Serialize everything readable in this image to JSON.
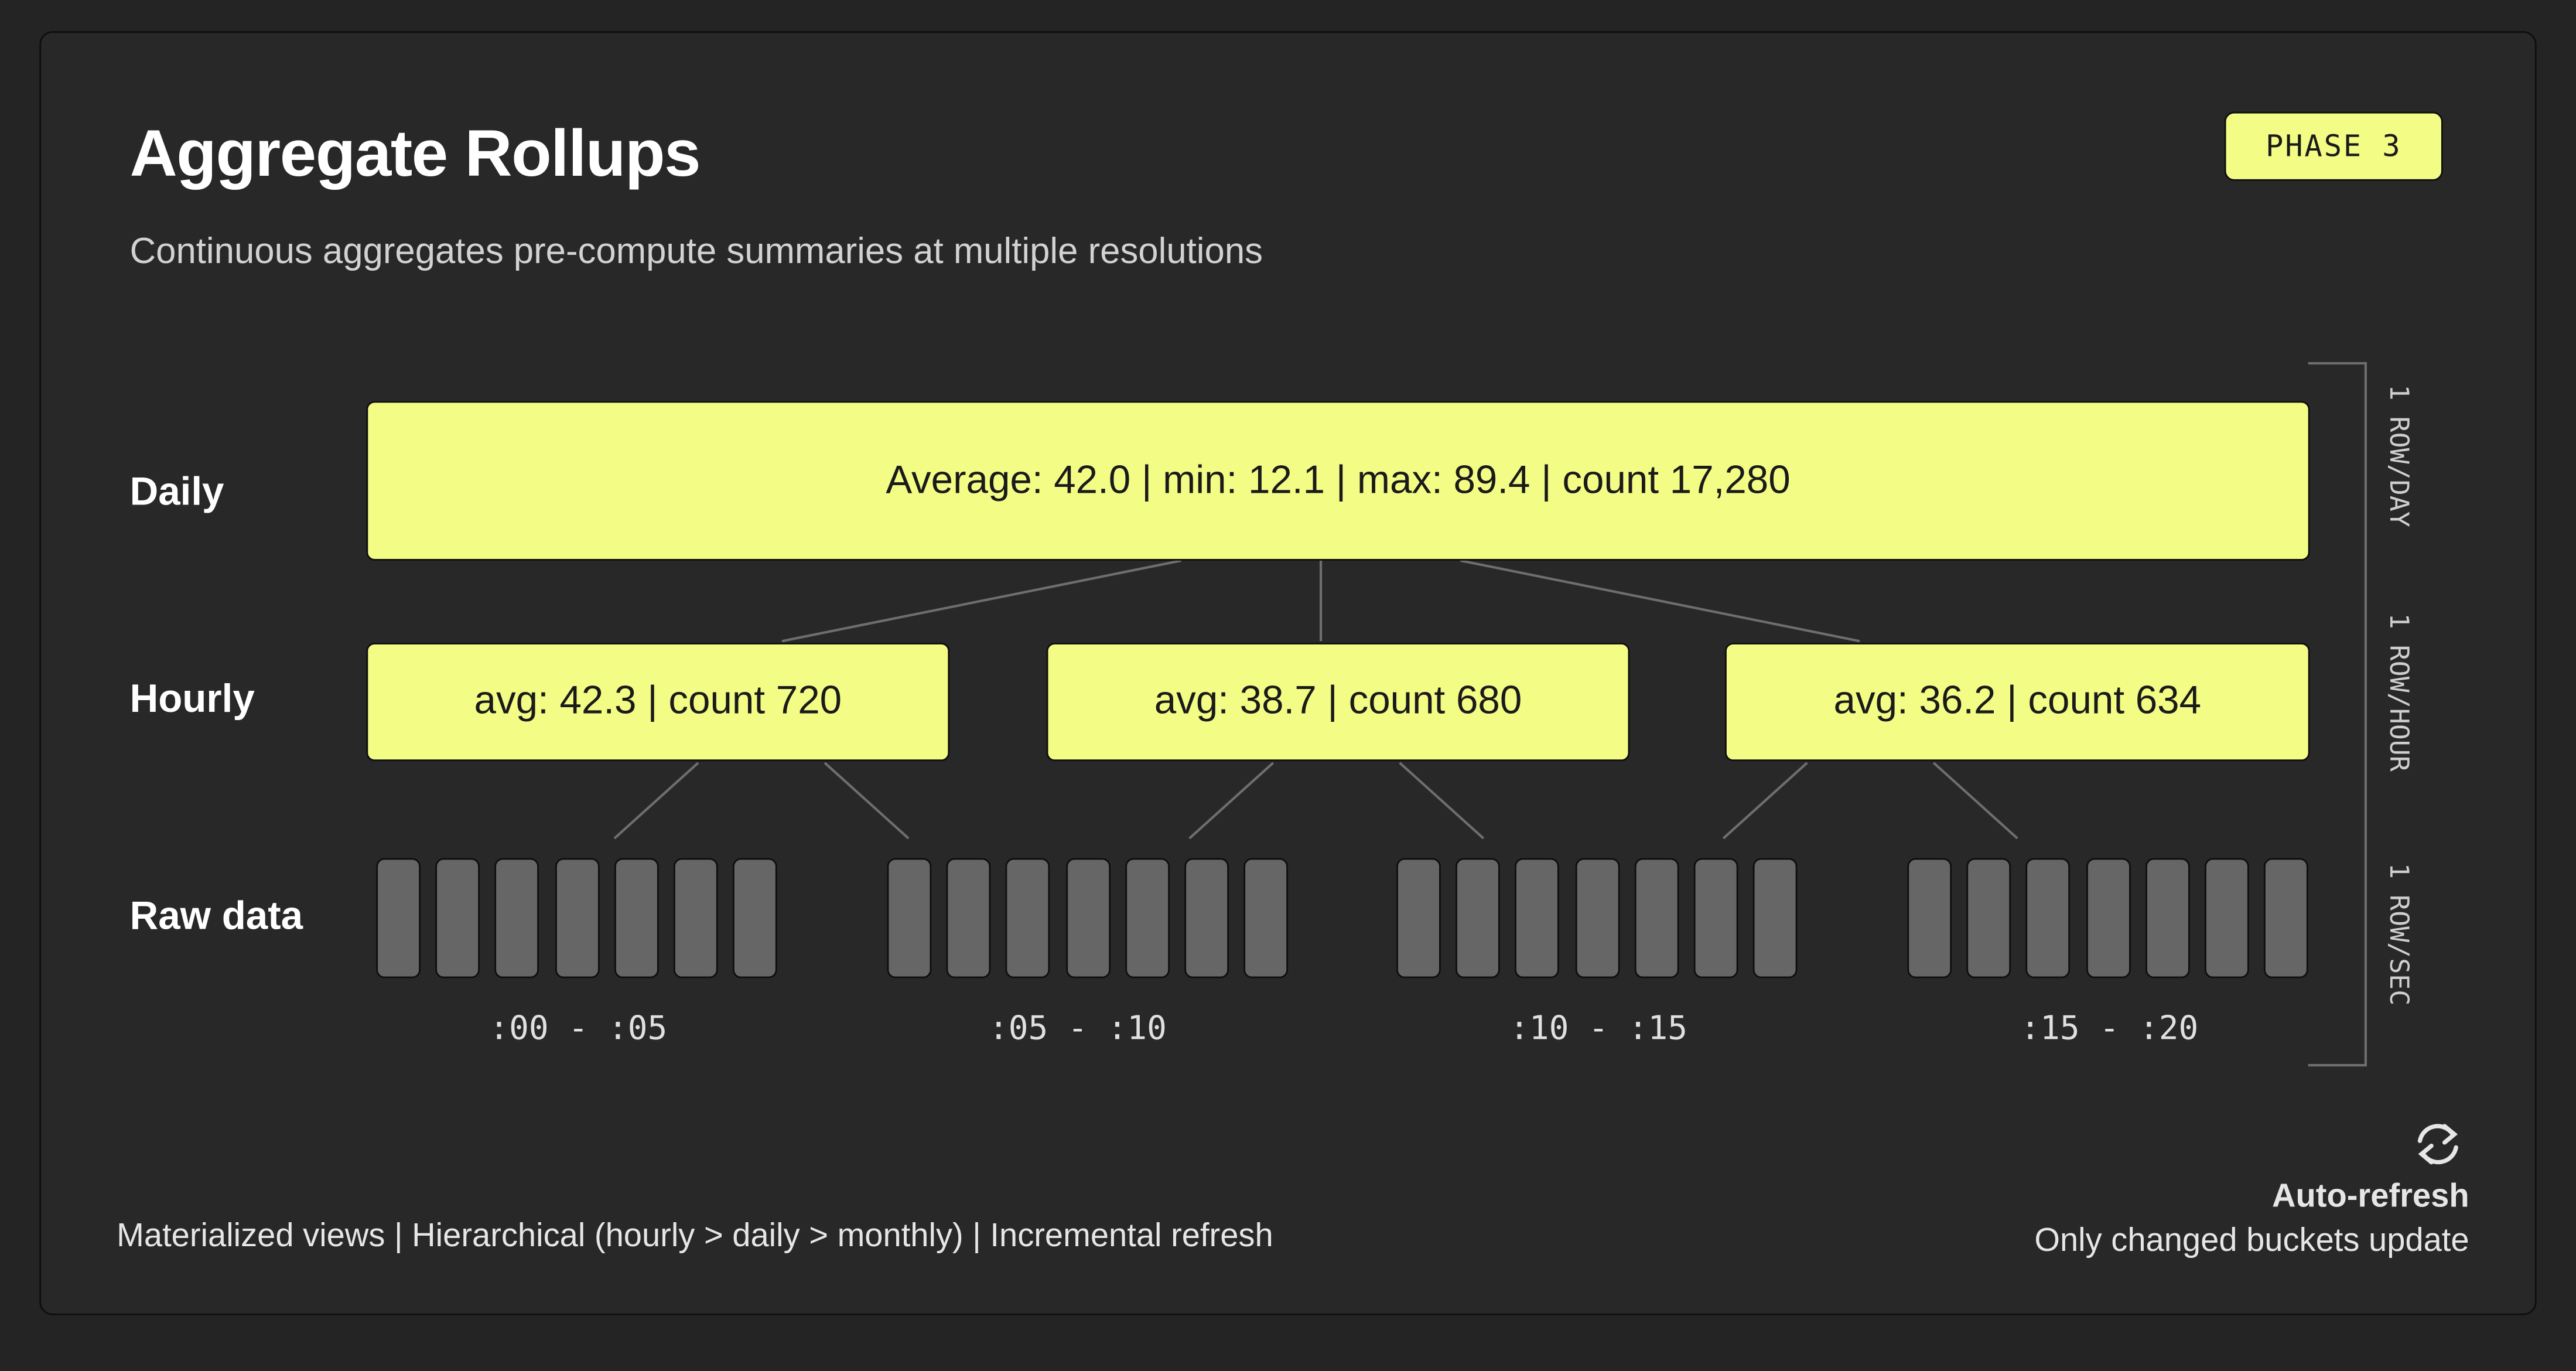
{
  "header": {
    "title": "Aggregate Rollups",
    "subtitle": "Continuous aggregates pre-compute summaries at multiple resolutions",
    "badge": "PHASE 3"
  },
  "levels": {
    "daily": "Daily",
    "hourly": "Hourly",
    "raw": "Raw data"
  },
  "daily_box": "Average: 42.0 | min: 12.1 | max: 89.4 | count 17,280",
  "hourly_boxes": [
    "avg: 42.3 | count 720",
    "avg: 38.7 | count 680",
    "avg: 36.2 | count 634"
  ],
  "raw_groups": [
    {
      "range": ":00 - :05",
      "bars": 7
    },
    {
      "range": ":05 - :10",
      "bars": 7
    },
    {
      "range": ":10 - :15",
      "bars": 7
    },
    {
      "range": ":15 - :20",
      "bars": 7
    }
  ],
  "granularity": {
    "daily": "1 ROW/DAY",
    "hourly": "1 ROW/HOUR",
    "raw": "1 ROW/SEC"
  },
  "footer": "Materialized views | Hierarchical (hourly > daily > monthly) | Incremental refresh",
  "refresh": {
    "icon": "refresh-icon",
    "title": "Auto-refresh",
    "subtitle": "Only changed buckets update"
  },
  "colors": {
    "background": "#242424",
    "panel": "#282828",
    "accent": "#f3fc85",
    "raw_bar": "#666666",
    "connector": "#6e6e6e"
  }
}
